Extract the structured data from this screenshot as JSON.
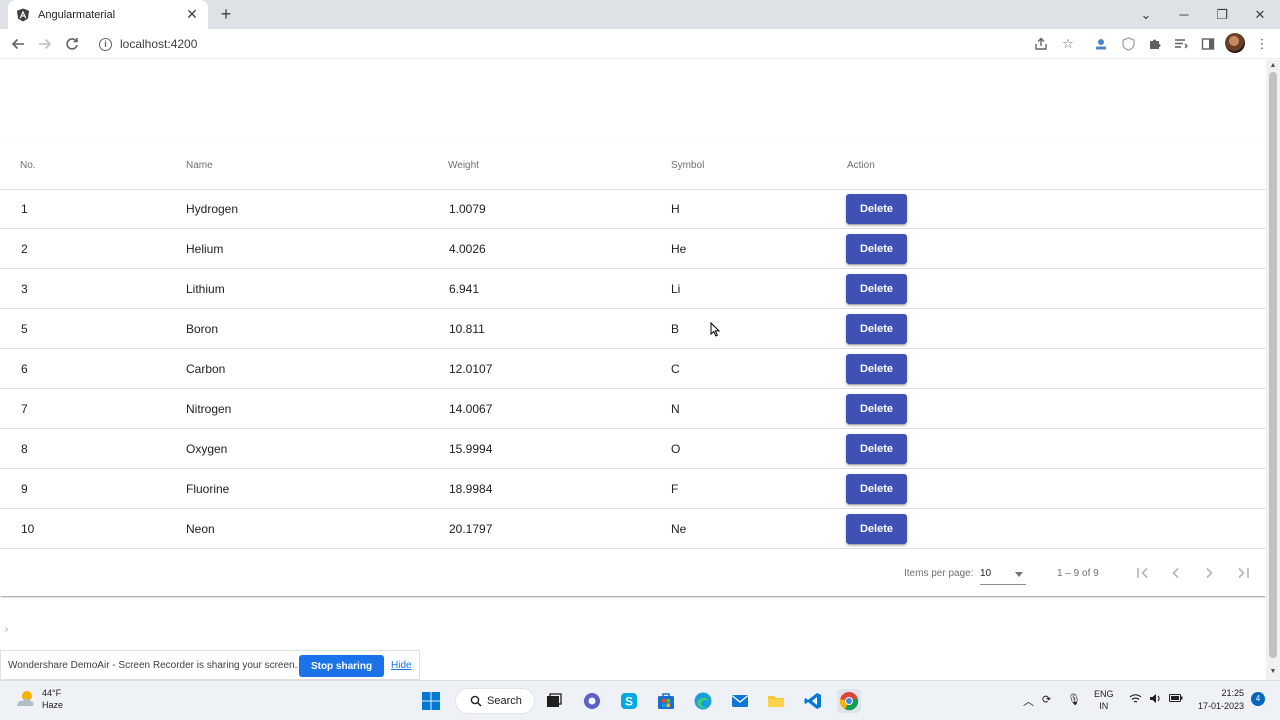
{
  "browser": {
    "tab_title": "Angularmaterial",
    "url": "localhost:4200"
  },
  "table": {
    "headers": [
      "No.",
      "Name",
      "Weight",
      "Symbol",
      "Action"
    ],
    "rows": [
      {
        "no": "1",
        "name": "Hydrogen",
        "weight": "1.0079",
        "symbol": "H",
        "action": "Delete"
      },
      {
        "no": "2",
        "name": "Helium",
        "weight": "4.0026",
        "symbol": "He",
        "action": "Delete"
      },
      {
        "no": "3",
        "name": "Lithium",
        "weight": "6.941",
        "symbol": "Li",
        "action": "Delete"
      },
      {
        "no": "5",
        "name": "Boron",
        "weight": "10.811",
        "symbol": "B",
        "action": "Delete"
      },
      {
        "no": "6",
        "name": "Carbon",
        "weight": "12.0107",
        "symbol": "C",
        "action": "Delete"
      },
      {
        "no": "7",
        "name": "Nitrogen",
        "weight": "14.0067",
        "symbol": "N",
        "action": "Delete"
      },
      {
        "no": "8",
        "name": "Oxygen",
        "weight": "15.9994",
        "symbol": "O",
        "action": "Delete"
      },
      {
        "no": "9",
        "name": "Fluorine",
        "weight": "18.9984",
        "symbol": "F",
        "action": "Delete"
      },
      {
        "no": "10",
        "name": "Neon",
        "weight": "20.1797",
        "symbol": "Ne",
        "action": "Delete"
      }
    ]
  },
  "paginator": {
    "items_per_page_label": "Items per page:",
    "items_per_page_value": "10",
    "range_label": "1 – 9 of 9"
  },
  "share_bar": {
    "message": "Wondershare DemoAir - Screen Recorder is sharing your screen.",
    "stop_label": "Stop sharing",
    "hide_label": "Hide"
  },
  "taskbar": {
    "weather_temp": "44°F",
    "weather_desc": "Haze",
    "search_label": "Search",
    "lang_top": "ENG",
    "lang_bottom": "IN",
    "time": "21:25",
    "date": "17-01-2023",
    "notification_count": "4"
  },
  "colors": {
    "primary": "#3f51b5",
    "share_blue": "#1a73e8"
  }
}
